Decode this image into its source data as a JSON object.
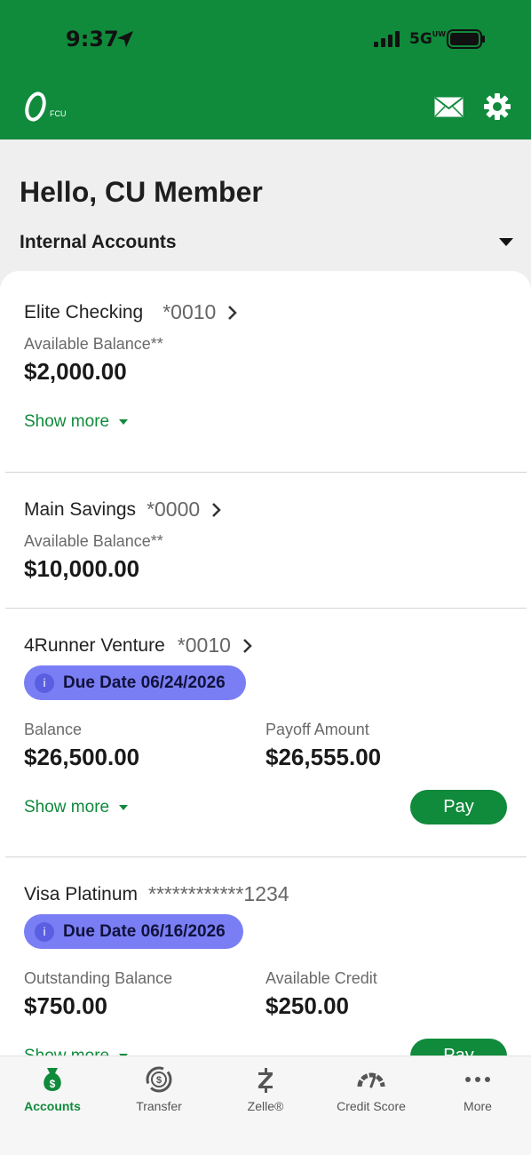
{
  "status_bar": {
    "time": "9:37",
    "network": "5G",
    "network_sup": "UW"
  },
  "header": {
    "logo_text": "FCU"
  },
  "greeting": "Hello, CU Member",
  "account_selector": {
    "selected": "Internal Accounts"
  },
  "accounts": [
    {
      "name": "Elite Checking",
      "number": "*0010",
      "balance_label": "Available Balance**",
      "balance": "$2,000.00",
      "show_more": "Show more"
    },
    {
      "name": "Main Savings",
      "number": "*0000",
      "balance_label": "Available Balance**",
      "balance": "$10,000.00"
    },
    {
      "name": "4Runner Venture",
      "number": "*0010",
      "due": "Due Date 06/24/2026",
      "balance_label": "Balance",
      "balance": "$26,500.00",
      "secondary_label": "Payoff Amount",
      "secondary_value": "$26,555.00",
      "show_more": "Show more",
      "action": "Pay"
    },
    {
      "name": "Visa Platinum",
      "number": "************1234",
      "due": "Due Date 06/16/2026",
      "balance_label": "Outstanding Balance",
      "balance": "$750.00",
      "secondary_label": "Available Credit",
      "secondary_value": "$250.00",
      "show_more": "Show more",
      "action": "Pay"
    }
  ],
  "tabs": [
    {
      "label": "Accounts",
      "icon": "money-bag-icon",
      "active": true
    },
    {
      "label": "Transfer",
      "icon": "transfer-icon"
    },
    {
      "label": "Zelle®",
      "icon": "zelle-icon"
    },
    {
      "label": "Credit Score",
      "icon": "gauge-icon"
    },
    {
      "label": "More",
      "icon": "more-dots-icon"
    }
  ],
  "colors": {
    "brand_green": "#108a3b",
    "due_pill": "#7a7ef5",
    "background": "#efeff0"
  }
}
